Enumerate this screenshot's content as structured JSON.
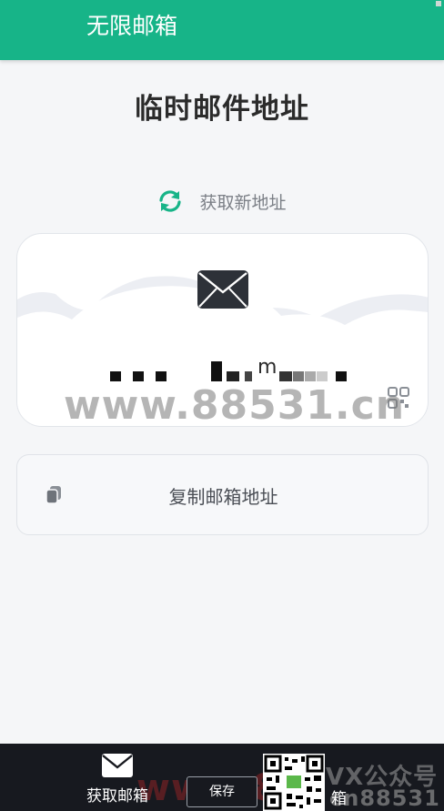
{
  "app_bar": {
    "title": "无限邮箱"
  },
  "page": {
    "title": "临时邮件地址"
  },
  "refresh": {
    "label": "获取新地址"
  },
  "mail_card": {
    "address_suffix": "m"
  },
  "watermark": {
    "text": "www.88531.cn"
  },
  "copy": {
    "label": "复制邮箱地址"
  },
  "bottom_bar": {
    "get_mailbox_label": "获取邮箱",
    "save_label": "保存",
    "mailbox_label": "箱",
    "watermark_top": "VX公众号",
    "watermark_bottom": "cn88531",
    "watermark_red": "www.88"
  },
  "colors": {
    "accent": "#17b488",
    "bottom_bar": "#17191f",
    "text_dark": "#2b2b2b",
    "text_muted": "#7b7f86"
  },
  "icons": {
    "refresh": "refresh-icon",
    "envelope": "envelope-icon",
    "qr": "qr-code-icon",
    "copy": "copy-icon"
  }
}
